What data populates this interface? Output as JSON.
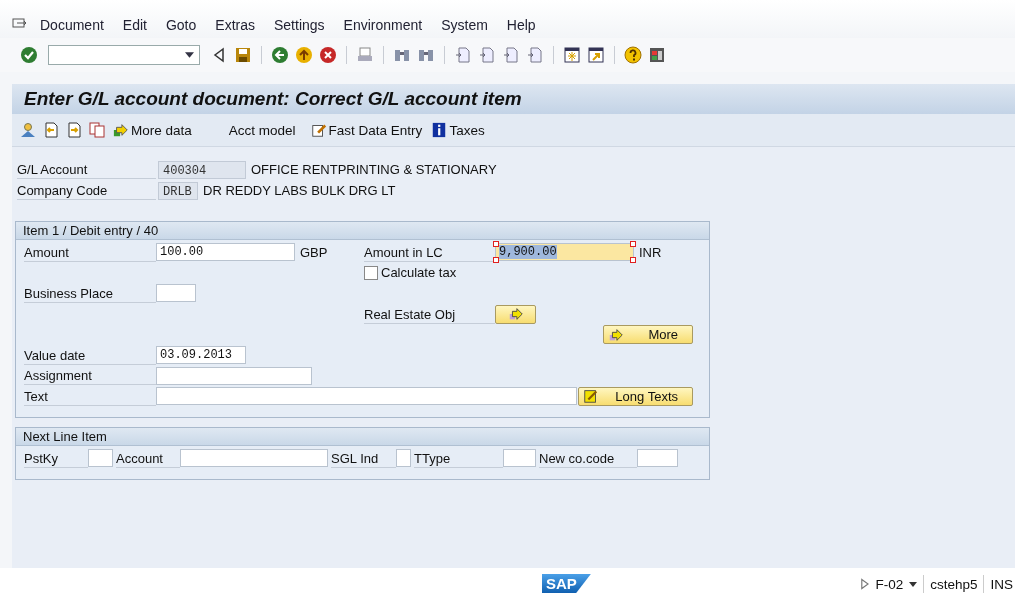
{
  "menu": [
    {
      "label": "Document"
    },
    {
      "label": "Edit"
    },
    {
      "label": "Goto"
    },
    {
      "label": "Extras"
    },
    {
      "label": "Settings"
    },
    {
      "label": "Environment"
    },
    {
      "label": "System"
    },
    {
      "label": "Help"
    }
  ],
  "title": "Enter G/L account document: Correct G/L account item",
  "app_toolbar": [
    {
      "kind": "arrow",
      "label": "More data"
    },
    {
      "kind": "plain",
      "label": "Acct model"
    },
    {
      "kind": "edit",
      "label": "Fast Data Entry"
    },
    {
      "kind": "info",
      "label": "Taxes"
    }
  ],
  "header": [
    {
      "label": "G/L Account",
      "value": "400304",
      "text": "OFFICE RENTPRINTING & STATIONARY"
    },
    {
      "label": "Company Code",
      "value": "DRLB",
      "text": "DR REDDY LABS BULK DRG LT"
    }
  ],
  "item": {
    "title": "Item 1 / Debit entry / 40",
    "amount": {
      "label": "Amount",
      "value": "100.00",
      "unit": "GBP"
    },
    "amount_lc": {
      "label": "Amount in LC",
      "value": "9,900.00",
      "unit": "INR",
      "highlighted": true
    },
    "calculate_tax": {
      "label": "Calculate tax",
      "checked": false
    },
    "business_place": {
      "label": "Business Place"
    },
    "real_estate": {
      "label": "Real Estate Obj"
    },
    "more_button": "More",
    "value_date": {
      "label": "Value date",
      "value": "03.09.2013"
    },
    "assignment": {
      "label": "Assignment"
    },
    "text": {
      "label": "Text"
    },
    "long_texts_button": "Long Texts"
  },
  "next_line": {
    "title": "Next Line Item",
    "fields": [
      {
        "label": "PstKy"
      },
      {
        "label": "Account"
      },
      {
        "label": "SGL Ind"
      },
      {
        "label": "TType"
      },
      {
        "label": "New co.code"
      }
    ]
  },
  "status": {
    "logo": "SAP",
    "transaction": "F-02",
    "server": "cstehp5",
    "mode": "INS"
  }
}
